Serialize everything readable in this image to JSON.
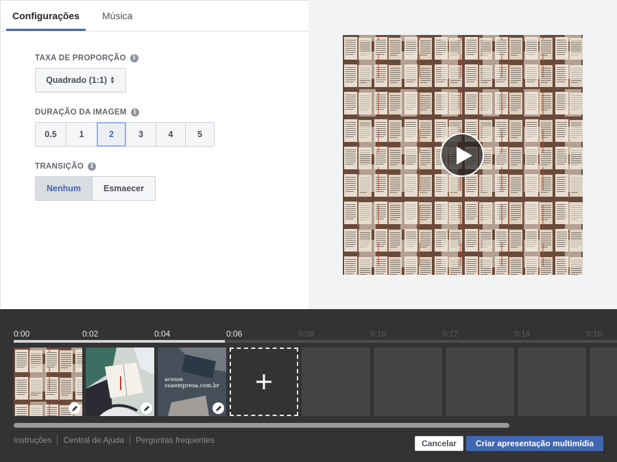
{
  "tabs": [
    {
      "label": "Configurações",
      "active": true
    },
    {
      "label": "Música",
      "active": false
    }
  ],
  "aspect_ratio": {
    "label": "TAXA DE PROPORÇÃO",
    "value": "Quadrado (1:1)",
    "icon": "info-icon"
  },
  "image_duration": {
    "label": "DURAÇÃO DA IMAGEM",
    "options": [
      "0.5",
      "1",
      "2",
      "3",
      "4",
      "5"
    ],
    "selected": "2",
    "icon": "info-icon"
  },
  "transition": {
    "label": "TRANSIÇÃO",
    "options": [
      "Nenhum",
      "Esmaecer"
    ],
    "selected": "Nenhum",
    "icon": "info-icon"
  },
  "preview": {
    "icon": "play-icon"
  },
  "timeline": {
    "ticks": [
      "0:00",
      "0:02",
      "0:04",
      "0:06",
      "0:08",
      "0:10",
      "0:12",
      "0:14",
      "0:16"
    ],
    "active_ticks": 4,
    "progress_fraction": 0.35,
    "clips": [
      {
        "kind": "image",
        "theme": "books",
        "edit_icon": "pencil-icon"
      },
      {
        "kind": "image",
        "theme": "reading",
        "edit_icon": "pencil-icon"
      },
      {
        "kind": "image",
        "theme": "promo",
        "text": "acesse\nsuaempresa.com.br",
        "edit_icon": "pencil-icon"
      },
      {
        "kind": "add",
        "icon": "plus-icon"
      },
      {
        "kind": "empty"
      },
      {
        "kind": "empty"
      },
      {
        "kind": "empty"
      },
      {
        "kind": "empty"
      },
      {
        "kind": "empty"
      }
    ]
  },
  "footer": {
    "links": [
      "Instruções",
      "Central de Ajuda",
      "Perguntas frequentes"
    ],
    "cancel": "Cancelar",
    "create": "Criar apresentação multimídia"
  },
  "colors": {
    "accent": "#4267b2",
    "timeline_bg": "#333333",
    "preview_bg": "#f2f3f5"
  }
}
